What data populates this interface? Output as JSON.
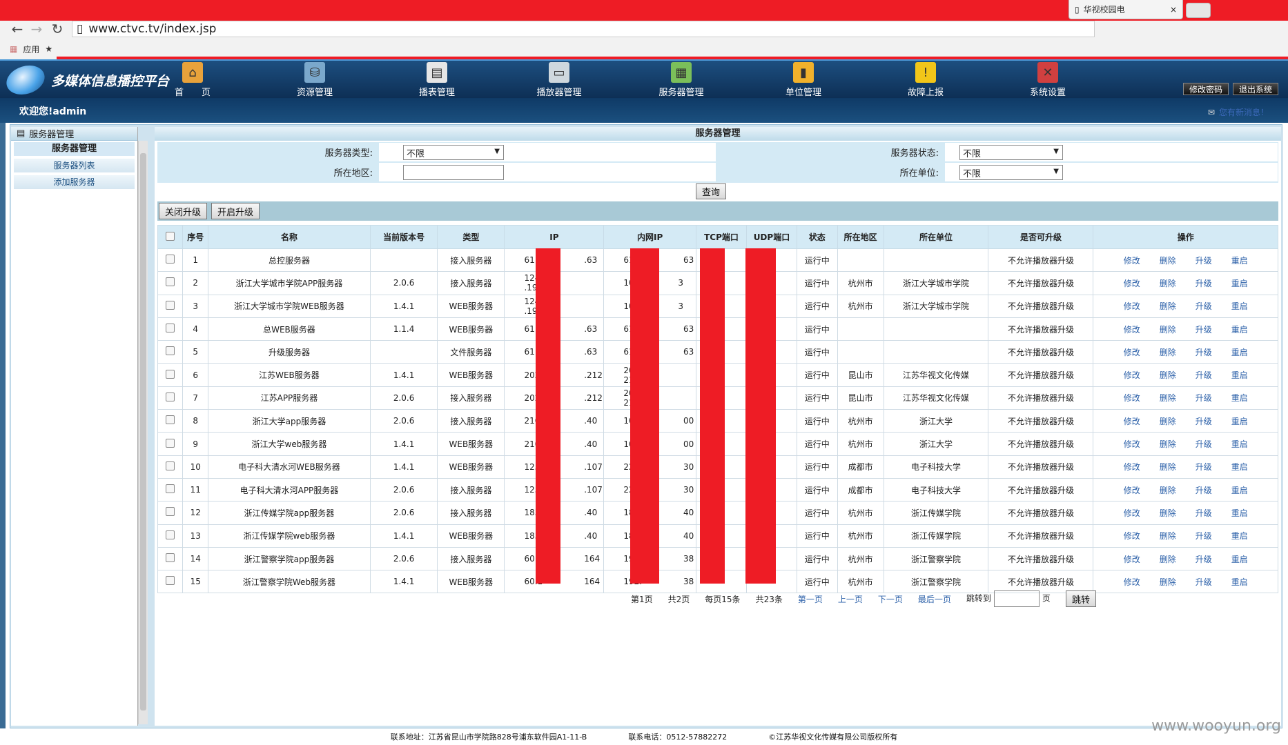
{
  "browser": {
    "tab_title": "华视校园电",
    "url": "www.ctvc.tv/index.jsp",
    "bookmarks_label": "应用"
  },
  "header": {
    "logo_title": "多媒体信息播控平台",
    "nav": [
      {
        "label": "首　　页",
        "icon": "home-icon",
        "color": "#e8a23b"
      },
      {
        "label": "资源管理",
        "icon": "database-icon",
        "color": "#7aa8cc"
      },
      {
        "label": "播表管理",
        "icon": "document-icon",
        "color": "#e6e6e6"
      },
      {
        "label": "播放器管理",
        "icon": "monitor-icon",
        "color": "#cfd8de"
      },
      {
        "label": "服务器管理",
        "icon": "server-chart-icon",
        "color": "#7bbf5a"
      },
      {
        "label": "单位管理",
        "icon": "bar-chart-icon",
        "color": "#f0b12c"
      },
      {
        "label": "故障上报",
        "icon": "warning-icon",
        "color": "#f2c619"
      },
      {
        "label": "系统设置",
        "icon": "tools-icon",
        "color": "#d04040"
      }
    ],
    "change_password": "修改密码",
    "logout": "退出系统",
    "welcome": "欢迎您!admin",
    "message": "您有新消息！"
  },
  "sidebar": {
    "panel_title": "服务器管理",
    "group": "服务器管理",
    "items": [
      "服务器列表",
      "添加服务器"
    ]
  },
  "main": {
    "title": "服务器管理",
    "filters": {
      "server_type_label": "服务器类型:",
      "server_type_value": "不限",
      "server_status_label": "服务器状态:",
      "server_status_value": "不限",
      "region_label": "所在地区:",
      "region_value": "",
      "unit_label": "所在单位:",
      "unit_value": "不限",
      "query_button": "查询"
    },
    "close_upgrade": "关闭升级",
    "open_upgrade": "开启升级",
    "columns": [
      "序号",
      "名称",
      "当前版本号",
      "类型",
      "IP",
      "内网IP",
      "TCP端口",
      "UDP端口",
      "状态",
      "所在地区",
      "所在单位",
      "是否可升级",
      "操作"
    ],
    "rows": [
      {
        "no": "1",
        "name": "总控服务器",
        "version": "",
        "type": "接入服务器",
        "ip": "61.1",
        "ip2": ".63",
        "lan": "61.1",
        "lan2": "63",
        "status": "运行中",
        "region": "",
        "unit": "",
        "upgrade": "不允许播放器升级"
      },
      {
        "no": "2",
        "name": "浙江大学城市学院APP服务器",
        "version": "2.0.6",
        "type": "接入服务器",
        "ip": "124.1",
        "ip2": ".195",
        "lan": "10.",
        "lan2": "3",
        "status": "运行中",
        "region": "杭州市",
        "unit": "浙江大学城市学院",
        "upgrade": "不允许播放器升级"
      },
      {
        "no": "3",
        "name": "浙江大学城市学院WEB服务器",
        "version": "1.4.1",
        "type": "WEB服务器",
        "ip": "124.1",
        "ip2": ".195",
        "lan": "10.",
        "lan2": "3",
        "status": "运行中",
        "region": "杭州市",
        "unit": "浙江大学城市学院",
        "upgrade": "不允许播放器升级"
      },
      {
        "no": "4",
        "name": "总WEB服务器",
        "version": "1.1.4",
        "type": "WEB服务器",
        "ip": "61.1",
        "ip2": ".63",
        "lan": "61.1",
        "lan2": "63",
        "status": "运行中",
        "region": "",
        "unit": "",
        "upgrade": "不允许播放器升级"
      },
      {
        "no": "5",
        "name": "升级服务器",
        "version": "",
        "type": "文件服务器",
        "ip": "61.1",
        "ip2": ".63",
        "lan": "61.1",
        "lan2": "63",
        "status": "运行中",
        "region": "",
        "unit": "",
        "upgrade": "不允许播放器升级"
      },
      {
        "no": "6",
        "name": "江苏WEB服务器",
        "version": "1.4.1",
        "type": "WEB服务器",
        "ip": "202.",
        "ip2": ".212",
        "lan": "202.",
        "lan2": "212",
        "status": "运行中",
        "region": "昆山市",
        "unit": "江苏华视文化传媒",
        "upgrade": "不允许播放器升级"
      },
      {
        "no": "7",
        "name": "江苏APP服务器",
        "version": "2.0.6",
        "type": "接入服务器",
        "ip": "202.",
        "ip2": ".212",
        "lan": "202.",
        "lan2": "212",
        "status": "运行中",
        "region": "昆山市",
        "unit": "江苏华视文化传媒",
        "upgrade": "不允许播放器升级"
      },
      {
        "no": "8",
        "name": "浙江大学app服务器",
        "version": "2.0.6",
        "type": "接入服务器",
        "ip": "210.",
        "ip2": ".40",
        "lan": "10.7",
        "lan2": "00",
        "status": "运行中",
        "region": "杭州市",
        "unit": "浙江大学",
        "upgrade": "不允许播放器升级"
      },
      {
        "no": "9",
        "name": "浙江大学web服务器",
        "version": "1.4.1",
        "type": "WEB服务器",
        "ip": "210.",
        "ip2": ".40",
        "lan": "10.7",
        "lan2": "00",
        "status": "运行中",
        "region": "杭州市",
        "unit": "浙江大学",
        "upgrade": "不允许播放器升级"
      },
      {
        "no": "10",
        "name": "电子科大清水河WEB服务器",
        "version": "1.4.1",
        "type": "WEB服务器",
        "ip": "125.",
        "ip2": ".107",
        "lan": "222.",
        "lan2": "30",
        "status": "运行中",
        "region": "成都市",
        "unit": "电子科技大学",
        "upgrade": "不允许播放器升级"
      },
      {
        "no": "11",
        "name": "电子科大清水河APP服务器",
        "version": "2.0.6",
        "type": "接入服务器",
        "ip": "125.",
        "ip2": ".107",
        "lan": "222.",
        "lan2": "30",
        "status": "运行中",
        "region": "成都市",
        "unit": "电子科技大学",
        "upgrade": "不允许播放器升级"
      },
      {
        "no": "12",
        "name": "浙江传媒学院app服务器",
        "version": "2.0.6",
        "type": "接入服务器",
        "ip": "183.",
        "ip2": ".40",
        "lan": "183.",
        "lan2": "40",
        "status": "运行中",
        "region": "杭州市",
        "unit": "浙江传媒学院",
        "upgrade": "不允许播放器升级"
      },
      {
        "no": "13",
        "name": "浙江传媒学院web服务器",
        "version": "1.4.1",
        "type": "WEB服务器",
        "ip": "183.",
        "ip2": ".40",
        "lan": "183.",
        "lan2": "40",
        "status": "运行中",
        "region": "杭州市",
        "unit": "浙江传媒学院",
        "upgrade": "不允许播放器升级"
      },
      {
        "no": "14",
        "name": "浙江警察学院app服务器",
        "version": "2.0.6",
        "type": "接入服务器",
        "ip": "60.1",
        "ip2": "164",
        "lan": "192.",
        "lan2": "38",
        "status": "运行中",
        "region": "杭州市",
        "unit": "浙江警察学院",
        "upgrade": "不允许播放器升级"
      },
      {
        "no": "15",
        "name": "浙江警察学院Web服务器",
        "version": "1.4.1",
        "type": "WEB服务器",
        "ip": "60.1",
        "ip2": "164",
        "lan": "192.",
        "lan2": "38",
        "status": "运行中",
        "region": "杭州市",
        "unit": "浙江警察学院",
        "upgrade": "不允许播放器升级"
      }
    ],
    "row_ops": [
      "修改",
      "删除",
      "升级",
      "重启"
    ],
    "pager": {
      "current": "第1页",
      "total_pages": "共2页",
      "per_page": "每页15条",
      "total_records": "共23条",
      "first": "第一页",
      "prev": "上一页",
      "next": "下一页",
      "last": "最后一页",
      "jump_to": "跳转到",
      "page_unit": "页",
      "jump_button": "跳转"
    }
  },
  "footer": {
    "address": "联系地址：江苏省昆山市学院路828号浦东软件园A1-11-B",
    "phone": "联系电话：0512-57882272",
    "copyright": "©江苏华视文化传媒有限公司版权所有"
  },
  "watermark": "www.wooyun.org",
  "colors": {
    "redaction": "#ee1c25",
    "header": "#0d2f55",
    "link": "#2a5fa8"
  }
}
